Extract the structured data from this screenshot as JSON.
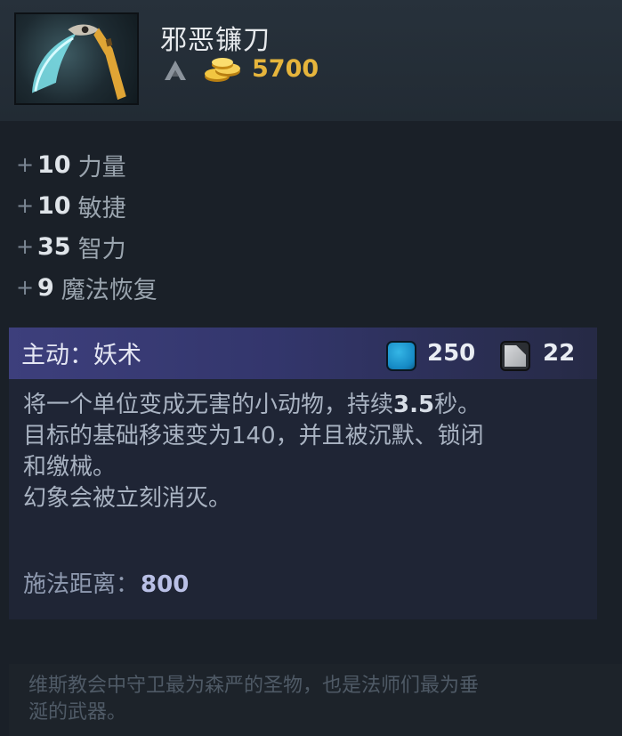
{
  "item": {
    "name": "邪恶镰刀",
    "price": "5700",
    "icon": "scythe-icon"
  },
  "stats": [
    {
      "plus": "+",
      "value": "10",
      "name": "力量"
    },
    {
      "plus": "+",
      "value": "10",
      "name": "敏捷"
    },
    {
      "plus": "+",
      "value": "35",
      "name": "智力"
    },
    {
      "plus": "+",
      "value": "9",
      "name": "魔法恢复"
    }
  ],
  "ability": {
    "title": "主动：妖术",
    "mana_cost": "250",
    "cooldown": "22",
    "desc_line1_pre": "将一个单位变成无害的小动物，持续",
    "desc_line1_num": "3.5",
    "desc_line1_post": "秒。",
    "desc_line2": "目标的基础移速变为140，并且被沉默、锁闭",
    "desc_line3": "和缴械。",
    "desc_line4": "幻象会被立刻消灭。",
    "cast_range_label": "施法距离：",
    "cast_range_value": "800"
  },
  "lore": {
    "line1": "维斯教会中守卫最为森严的圣物，也是法师们最为垂",
    "line2": "涎的武器。"
  },
  "colors": {
    "gold": "#e6b53c",
    "mana": "#1589c4",
    "ability_header": "#3d3f7c"
  }
}
